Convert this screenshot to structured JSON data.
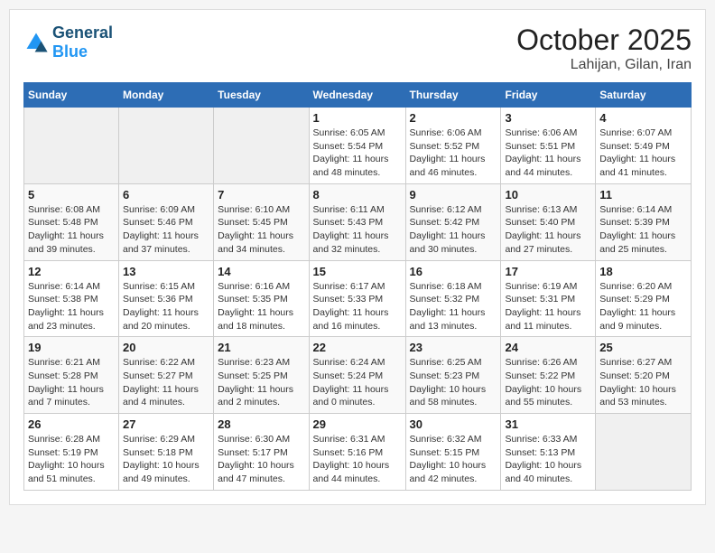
{
  "header": {
    "logo_line1": "General",
    "logo_line2": "Blue",
    "month": "October 2025",
    "location": "Lahijan, Gilan, Iran"
  },
  "weekdays": [
    "Sunday",
    "Monday",
    "Tuesday",
    "Wednesday",
    "Thursday",
    "Friday",
    "Saturday"
  ],
  "weeks": [
    [
      {
        "day": "",
        "info": ""
      },
      {
        "day": "",
        "info": ""
      },
      {
        "day": "",
        "info": ""
      },
      {
        "day": "1",
        "info": "Sunrise: 6:05 AM\nSunset: 5:54 PM\nDaylight: 11 hours\nand 48 minutes."
      },
      {
        "day": "2",
        "info": "Sunrise: 6:06 AM\nSunset: 5:52 PM\nDaylight: 11 hours\nand 46 minutes."
      },
      {
        "day": "3",
        "info": "Sunrise: 6:06 AM\nSunset: 5:51 PM\nDaylight: 11 hours\nand 44 minutes."
      },
      {
        "day": "4",
        "info": "Sunrise: 6:07 AM\nSunset: 5:49 PM\nDaylight: 11 hours\nand 41 minutes."
      }
    ],
    [
      {
        "day": "5",
        "info": "Sunrise: 6:08 AM\nSunset: 5:48 PM\nDaylight: 11 hours\nand 39 minutes."
      },
      {
        "day": "6",
        "info": "Sunrise: 6:09 AM\nSunset: 5:46 PM\nDaylight: 11 hours\nand 37 minutes."
      },
      {
        "day": "7",
        "info": "Sunrise: 6:10 AM\nSunset: 5:45 PM\nDaylight: 11 hours\nand 34 minutes."
      },
      {
        "day": "8",
        "info": "Sunrise: 6:11 AM\nSunset: 5:43 PM\nDaylight: 11 hours\nand 32 minutes."
      },
      {
        "day": "9",
        "info": "Sunrise: 6:12 AM\nSunset: 5:42 PM\nDaylight: 11 hours\nand 30 minutes."
      },
      {
        "day": "10",
        "info": "Sunrise: 6:13 AM\nSunset: 5:40 PM\nDaylight: 11 hours\nand 27 minutes."
      },
      {
        "day": "11",
        "info": "Sunrise: 6:14 AM\nSunset: 5:39 PM\nDaylight: 11 hours\nand 25 minutes."
      }
    ],
    [
      {
        "day": "12",
        "info": "Sunrise: 6:14 AM\nSunset: 5:38 PM\nDaylight: 11 hours\nand 23 minutes."
      },
      {
        "day": "13",
        "info": "Sunrise: 6:15 AM\nSunset: 5:36 PM\nDaylight: 11 hours\nand 20 minutes."
      },
      {
        "day": "14",
        "info": "Sunrise: 6:16 AM\nSunset: 5:35 PM\nDaylight: 11 hours\nand 18 minutes."
      },
      {
        "day": "15",
        "info": "Sunrise: 6:17 AM\nSunset: 5:33 PM\nDaylight: 11 hours\nand 16 minutes."
      },
      {
        "day": "16",
        "info": "Sunrise: 6:18 AM\nSunset: 5:32 PM\nDaylight: 11 hours\nand 13 minutes."
      },
      {
        "day": "17",
        "info": "Sunrise: 6:19 AM\nSunset: 5:31 PM\nDaylight: 11 hours\nand 11 minutes."
      },
      {
        "day": "18",
        "info": "Sunrise: 6:20 AM\nSunset: 5:29 PM\nDaylight: 11 hours\nand 9 minutes."
      }
    ],
    [
      {
        "day": "19",
        "info": "Sunrise: 6:21 AM\nSunset: 5:28 PM\nDaylight: 11 hours\nand 7 minutes."
      },
      {
        "day": "20",
        "info": "Sunrise: 6:22 AM\nSunset: 5:27 PM\nDaylight: 11 hours\nand 4 minutes."
      },
      {
        "day": "21",
        "info": "Sunrise: 6:23 AM\nSunset: 5:25 PM\nDaylight: 11 hours\nand 2 minutes."
      },
      {
        "day": "22",
        "info": "Sunrise: 6:24 AM\nSunset: 5:24 PM\nDaylight: 11 hours\nand 0 minutes."
      },
      {
        "day": "23",
        "info": "Sunrise: 6:25 AM\nSunset: 5:23 PM\nDaylight: 10 hours\nand 58 minutes."
      },
      {
        "day": "24",
        "info": "Sunrise: 6:26 AM\nSunset: 5:22 PM\nDaylight: 10 hours\nand 55 minutes."
      },
      {
        "day": "25",
        "info": "Sunrise: 6:27 AM\nSunset: 5:20 PM\nDaylight: 10 hours\nand 53 minutes."
      }
    ],
    [
      {
        "day": "26",
        "info": "Sunrise: 6:28 AM\nSunset: 5:19 PM\nDaylight: 10 hours\nand 51 minutes."
      },
      {
        "day": "27",
        "info": "Sunrise: 6:29 AM\nSunset: 5:18 PM\nDaylight: 10 hours\nand 49 minutes."
      },
      {
        "day": "28",
        "info": "Sunrise: 6:30 AM\nSunset: 5:17 PM\nDaylight: 10 hours\nand 47 minutes."
      },
      {
        "day": "29",
        "info": "Sunrise: 6:31 AM\nSunset: 5:16 PM\nDaylight: 10 hours\nand 44 minutes."
      },
      {
        "day": "30",
        "info": "Sunrise: 6:32 AM\nSunset: 5:15 PM\nDaylight: 10 hours\nand 42 minutes."
      },
      {
        "day": "31",
        "info": "Sunrise: 6:33 AM\nSunset: 5:13 PM\nDaylight: 10 hours\nand 40 minutes."
      },
      {
        "day": "",
        "info": ""
      }
    ]
  ]
}
